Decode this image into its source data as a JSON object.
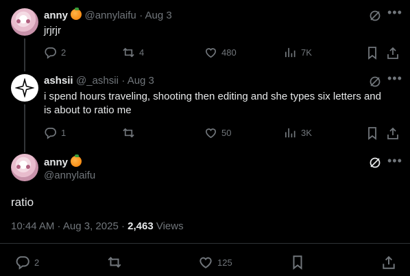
{
  "tweets": [
    {
      "name": "anny",
      "handle": "@annylaifu",
      "date": "· Aug 3",
      "text": "jrjrjr",
      "replies": "2",
      "retweets": "4",
      "likes": "480",
      "views": "7K"
    },
    {
      "name": "ashsii",
      "handle": "@_ashsii",
      "date": "· Aug 3",
      "text_line1": "i spend hours traveling, shooting then editing and she types six letters and",
      "text_line2": "is about to ratio me",
      "replies": "1",
      "likes": "50",
      "views": "3K"
    }
  ],
  "main_tweet": {
    "name": "anny",
    "handle": "@annylaifu",
    "text": "ratio",
    "timestamp": "10:44 AM · Aug 3, 2025 ·",
    "views_count": "2,463",
    "views_label": "Views",
    "replies": "2",
    "likes": "125"
  },
  "icons": {
    "reply": "reply-icon",
    "retweet": "retweet-icon",
    "like": "heart-icon",
    "views": "views-chart-icon",
    "bookmark": "bookmark-icon",
    "share": "share-icon",
    "grok": "grok-icon",
    "more": "more-icon",
    "verified_emoji": "orange-emoji"
  }
}
